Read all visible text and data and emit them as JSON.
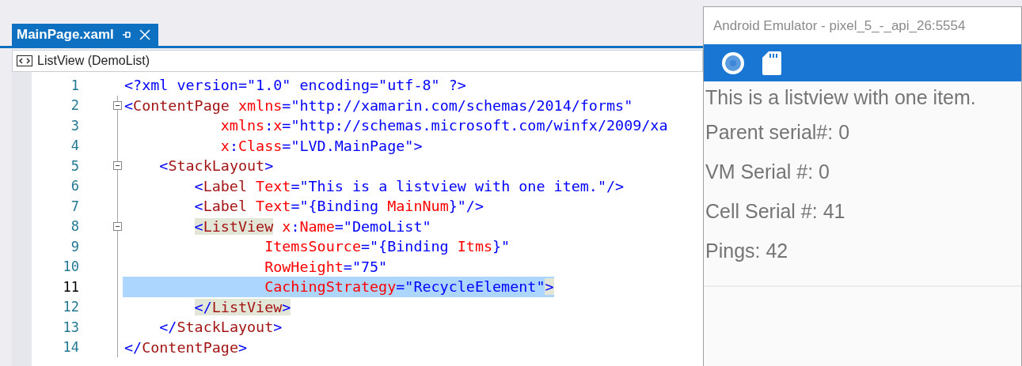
{
  "editor": {
    "tab": {
      "title": "MainPage.xaml",
      "selected": true
    },
    "breadcrumb": "ListView (DemoList)",
    "lines": [
      {
        "number": "1",
        "collapsible": false,
        "selected": false,
        "tokens": [
          {
            "kind": "bracket",
            "text": "<?xml version=\"1.0\" encoding=\"utf-8\" ?>"
          }
        ]
      },
      {
        "number": "2",
        "collapsible": true,
        "selected": false,
        "tokens": [
          {
            "kind": "bracket",
            "text": "<"
          },
          {
            "kind": "tag",
            "text": "ContentPage"
          },
          {
            "kind": "attr",
            "text": " xmlns"
          },
          {
            "kind": "bracket",
            "text": "=\"http://xamarin.com/schemas/2014/forms\""
          }
        ]
      },
      {
        "number": "3",
        "collapsible": false,
        "selected": false,
        "tokens": [
          {
            "kind": "attr",
            "text": "           xmlns"
          },
          {
            "kind": "bracket",
            "text": ":"
          },
          {
            "kind": "attr",
            "text": "x"
          },
          {
            "kind": "bracket",
            "text": "=\"http://schemas.microsoft.com/winfx/2009/xa"
          }
        ]
      },
      {
        "number": "4",
        "collapsible": false,
        "selected": false,
        "tokens": [
          {
            "kind": "attr",
            "text": "           x"
          },
          {
            "kind": "bracket",
            "text": ":"
          },
          {
            "kind": "attr",
            "text": "Class"
          },
          {
            "kind": "bracket",
            "text": "=\"LVD.MainPage\">"
          }
        ]
      },
      {
        "number": "5",
        "collapsible": true,
        "selected": false,
        "tokens": [
          {
            "kind": "bracket",
            "text": "    <"
          },
          {
            "kind": "tag",
            "text": "StackLayout"
          },
          {
            "kind": "bracket",
            "text": ">"
          }
        ]
      },
      {
        "number": "6",
        "collapsible": false,
        "selected": false,
        "tokens": [
          {
            "kind": "bracket",
            "text": "        <"
          },
          {
            "kind": "tag",
            "text": "Label"
          },
          {
            "kind": "attr",
            "text": " Text"
          },
          {
            "kind": "bracket",
            "text": "=\"This is a listview with one item.\"/>"
          }
        ]
      },
      {
        "number": "7",
        "collapsible": false,
        "selected": false,
        "tokens": [
          {
            "kind": "bracket",
            "text": "        <"
          },
          {
            "kind": "tag",
            "text": "Label"
          },
          {
            "kind": "attr",
            "text": " Text"
          },
          {
            "kind": "bracket",
            "text": "=\"{Binding "
          },
          {
            "kind": "attr",
            "text": "MainNum"
          },
          {
            "kind": "bracket",
            "text": "}\"/>"
          }
        ]
      },
      {
        "number": "8",
        "collapsible": true,
        "selected": false,
        "tokens": [
          {
            "kind": "match",
            "text": "        <"
          },
          {
            "kind": "match-tag",
            "text": "ListView"
          },
          {
            "kind": "attr",
            "text": " x"
          },
          {
            "kind": "bracket",
            "text": ":"
          },
          {
            "kind": "attr",
            "text": "Name"
          },
          {
            "kind": "bracket",
            "text": "=\"DemoList\""
          }
        ]
      },
      {
        "number": "9",
        "collapsible": false,
        "selected": false,
        "tokens": [
          {
            "kind": "attr",
            "text": "                ItemsSource"
          },
          {
            "kind": "bracket",
            "text": "=\"{Binding "
          },
          {
            "kind": "attr",
            "text": "Itms"
          },
          {
            "kind": "bracket",
            "text": "}\""
          }
        ]
      },
      {
        "number": "10",
        "collapsible": false,
        "selected": false,
        "tokens": [
          {
            "kind": "attr",
            "text": "                RowHeight"
          },
          {
            "kind": "bracket",
            "text": "=\"75\""
          }
        ]
      },
      {
        "number": "11",
        "collapsible": false,
        "selected": true,
        "tokens": [
          {
            "kind": "attr",
            "text": "                CachingStrategy"
          },
          {
            "kind": "bracket",
            "text": "=\"RecycleElement\""
          },
          {
            "kind": "match",
            "text": ">"
          }
        ]
      },
      {
        "number": "12",
        "collapsible": false,
        "selected": false,
        "tokens": [
          {
            "kind": "match",
            "text": "        </"
          },
          {
            "kind": "match-tag",
            "text": "ListView"
          },
          {
            "kind": "match",
            "text": ">"
          }
        ]
      },
      {
        "number": "13",
        "collapsible": false,
        "selected": false,
        "tokens": [
          {
            "kind": "bracket",
            "text": "    </"
          },
          {
            "kind": "tag",
            "text": "StackLayout"
          },
          {
            "kind": "bracket",
            "text": ">"
          }
        ]
      },
      {
        "number": "14",
        "collapsible": false,
        "selected": false,
        "tokens": [
          {
            "kind": "bracket",
            "text": "</"
          },
          {
            "kind": "tag",
            "text": "ContentPage"
          },
          {
            "kind": "bracket",
            "text": ">"
          }
        ]
      }
    ]
  },
  "emulator": {
    "title": "Android Emulator - pixel_5_-_api_26:5554",
    "labels": [
      "This is a listview with one item.",
      "Parent serial#: 0",
      "VM Serial #: 0",
      "Cell Serial #: 41",
      "Pings: 42"
    ]
  }
}
